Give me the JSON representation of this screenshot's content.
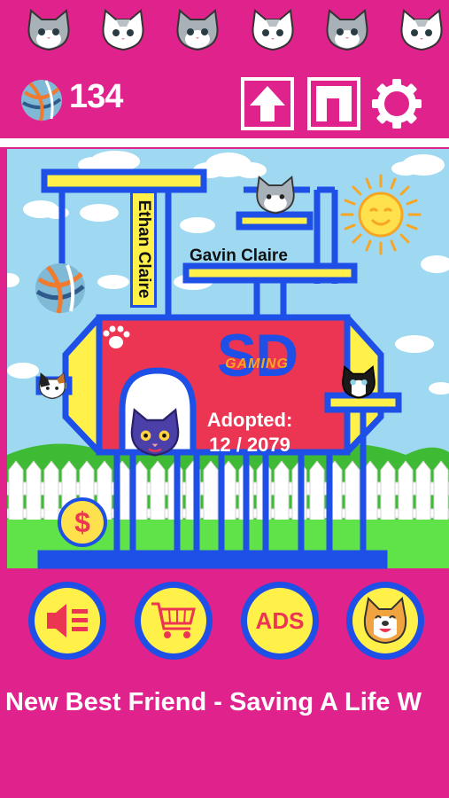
{
  "top_bar": {
    "cats": [
      "grey-cat-icon",
      "white-cat-icon",
      "grey-cat-icon",
      "white-cat-icon",
      "grey-cat-icon",
      "white-cat-icon"
    ]
  },
  "header": {
    "coins": "134"
  },
  "scene": {
    "sign_vertical": "Ethan Claire",
    "sign_horizontal": "Gavin Claire",
    "logo_big": "SD",
    "logo_small": "GAMING",
    "adopted_label": "Adopted:",
    "adopted_count": "12 / 2079"
  },
  "buttons": {
    "ads_label": "ADS"
  },
  "ticker": {
    "text": "New Best Friend      -     Saving A Life W"
  },
  "colors": {
    "magenta": "#E0228C",
    "blue": "#1E4FE6",
    "yellow": "#FFF14A",
    "red": "#EC3552",
    "sky": "#9ED8F1",
    "grass": "#5FE349"
  }
}
